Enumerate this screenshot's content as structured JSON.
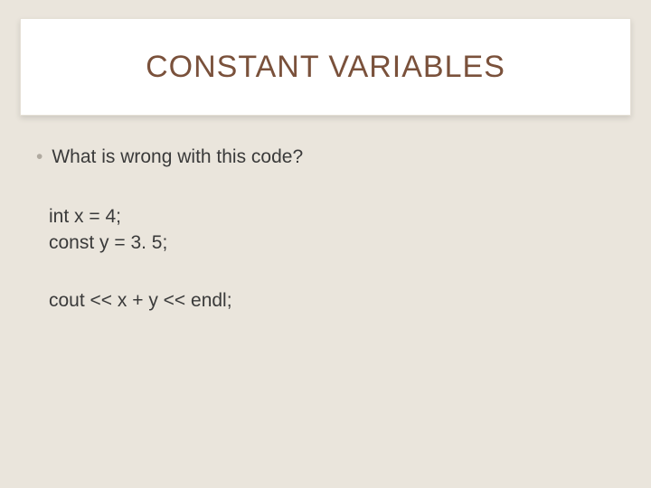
{
  "title": "CONSTANT VARIABLES",
  "bullet": "What is wrong with this code?",
  "code1_line1": "int x = 4;",
  "code1_line2": "const y = 3. 5;",
  "code2_line1": "cout << x + y << endl;"
}
